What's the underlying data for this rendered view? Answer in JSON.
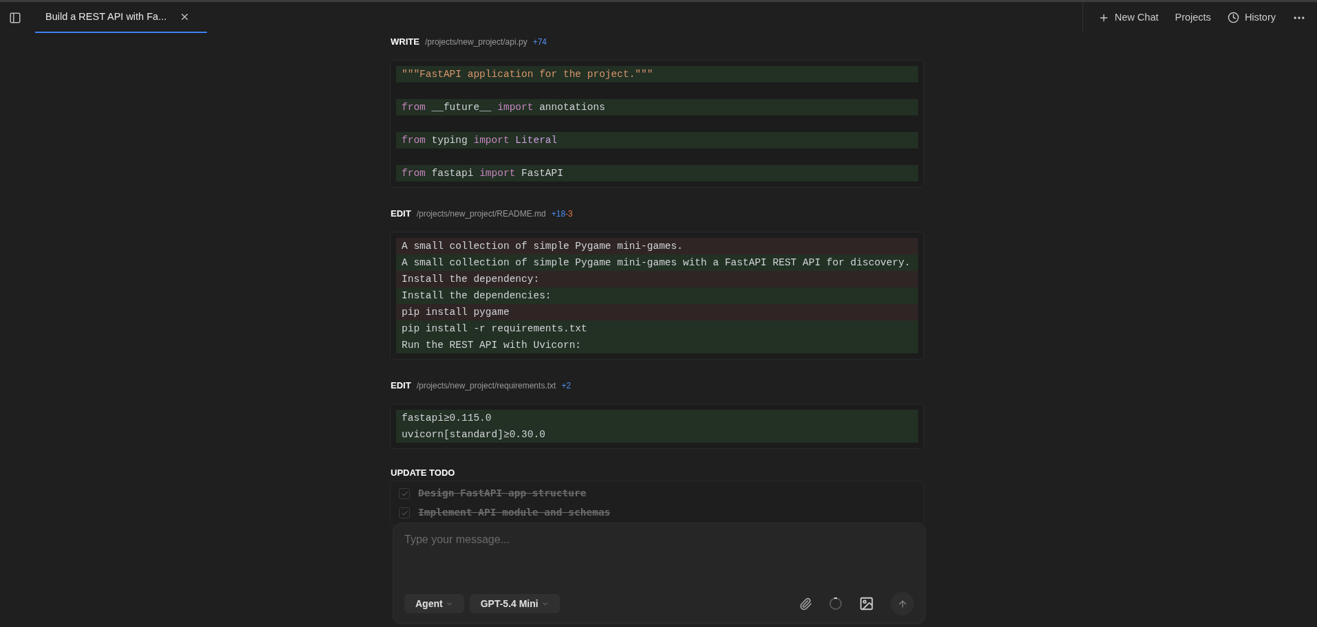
{
  "tab": {
    "title": "Build a REST API with Fa...",
    "selected": true
  },
  "toolbar": [
    "New Chat",
    "Projects",
    "History"
  ],
  "actions": [
    {
      "kind": "file",
      "action": "WRITE",
      "path": "/projects/new_project/api.py",
      "added": "+74",
      "lines": [
        {
          "kind": "added",
          "tokens": [
            {
              "kind": "string",
              "text": "\"\"\"FastAPI application for the project.\"\"\""
            }
          ]
        },
        {
          "kind": "blank"
        },
        {
          "kind": "added",
          "tokens": [
            {
              "kind": "keyword",
              "text": "from"
            },
            {
              "kind": "plain",
              "text": " __future__ "
            },
            {
              "kind": "keyword",
              "text": "import"
            },
            {
              "kind": "plain",
              "text": " annotations"
            }
          ]
        },
        {
          "kind": "blank"
        },
        {
          "kind": "added",
          "tokens": [
            {
              "kind": "keyword",
              "text": "from"
            },
            {
              "kind": "plain",
              "text": " typing "
            },
            {
              "kind": "keyword",
              "text": "import"
            },
            {
              "kind": "name",
              "text": " Literal"
            }
          ]
        },
        {
          "kind": "blank"
        },
        {
          "kind": "added",
          "tokens": [
            {
              "kind": "keyword",
              "text": "from"
            },
            {
              "kind": "plain",
              "text": " fastapi "
            },
            {
              "kind": "keyword",
              "text": "import"
            },
            {
              "kind": "plain",
              "text": " FastAPI"
            }
          ]
        }
      ]
    },
    {
      "kind": "file",
      "action": "EDIT",
      "path": "/projects/new_project/README.md",
      "added": "+18",
      "removed": "-3",
      "lines": [
        {
          "kind": "removed",
          "tokens": [
            {
              "kind": "plain",
              "text": "A small collection of simple Pygame mini-games."
            }
          ]
        },
        {
          "kind": "added",
          "tokens": [
            {
              "kind": "plain",
              "text": "A small collection of simple Pygame mini-games with a FastAPI REST API for discovery."
            }
          ]
        },
        {
          "kind": "removed",
          "tokens": [
            {
              "kind": "plain",
              "text": "Install the dependency:"
            }
          ]
        },
        {
          "kind": "added",
          "tokens": [
            {
              "kind": "plain",
              "text": "Install the dependencies:"
            }
          ]
        },
        {
          "kind": "removed",
          "tokens": [
            {
              "kind": "plain",
              "text": "pip install pygame"
            }
          ]
        },
        {
          "kind": "added",
          "tokens": [
            {
              "kind": "plain",
              "text": "pip install -r requirements.txt"
            }
          ]
        },
        {
          "kind": "added",
          "tokens": [
            {
              "kind": "plain",
              "text": "Run the REST API with Uvicorn:"
            }
          ]
        }
      ]
    },
    {
      "kind": "file",
      "action": "EDIT",
      "path": "/projects/new_project/requirements.txt",
      "added": "+2",
      "lines": [
        {
          "kind": "added",
          "tokens": [
            {
              "kind": "plain",
              "text": "fastapi≥0.115.0"
            }
          ]
        },
        {
          "kind": "added",
          "tokens": [
            {
              "kind": "plain",
              "text": "uvicorn[standard]≥0.30.0"
            }
          ]
        }
      ]
    },
    {
      "kind": "todo",
      "action": "UPDATE TODO",
      "items": [
        {
          "text": "Design FastAPI app structure",
          "checked": true
        },
        {
          "text": "Implement API module and schemas",
          "checked": true
        }
      ]
    }
  ],
  "composer": {
    "placeholder": "Type your message...",
    "mode": "Agent",
    "model": "GPT-5.4 Mini"
  }
}
